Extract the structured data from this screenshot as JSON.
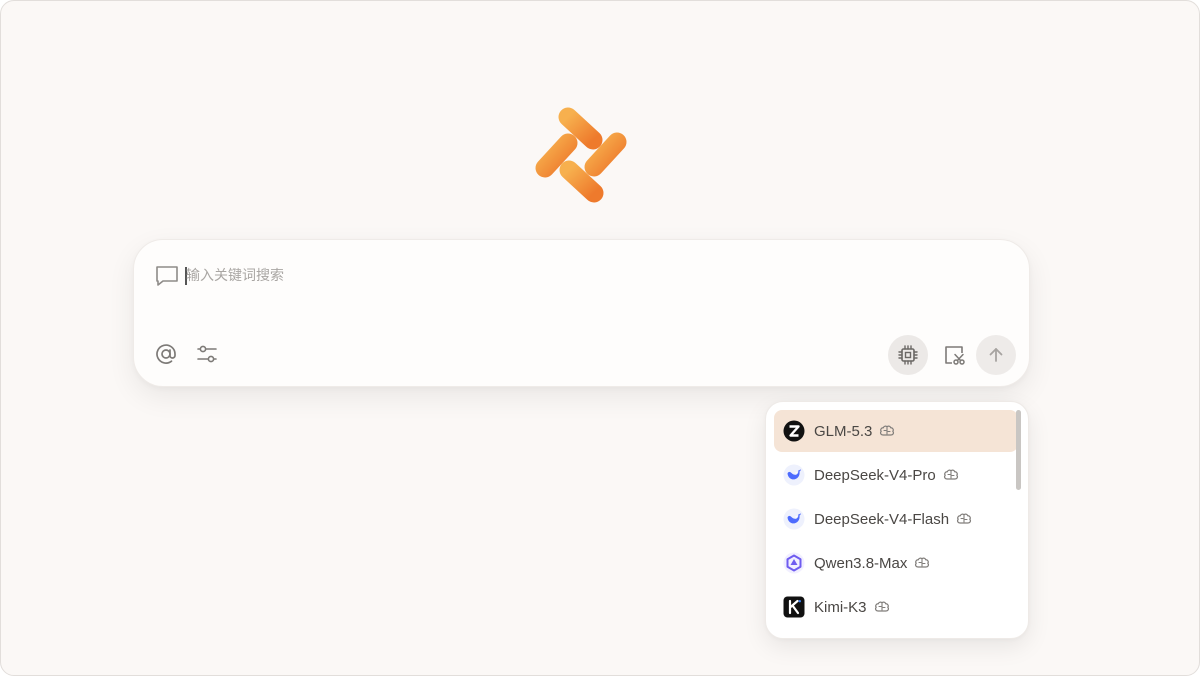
{
  "search": {
    "placeholder": "输入关键词搜索"
  },
  "toolbar": {
    "left_icons": [
      "at-icon",
      "sliders-icon"
    ],
    "right_icons": [
      "chip-icon",
      "screenshot-icon",
      "arrow-up-icon"
    ]
  },
  "colors": {
    "brand_orange": "#F2903A",
    "selected_bg": "#F5E4D6",
    "page_bg": "#FBF8F6"
  },
  "model_menu": {
    "selected_index": 0,
    "items": [
      {
        "label": "GLM-5.3",
        "icon": "zhipu-z-logo"
      },
      {
        "label": "DeepSeek-V4-Pro",
        "icon": "deepseek-whale-logo"
      },
      {
        "label": "DeepSeek-V4-Flash",
        "icon": "deepseek-whale-logo"
      },
      {
        "label": "Qwen3.8-Max",
        "icon": "qwen-logo"
      },
      {
        "label": "Kimi-K3",
        "icon": "kimi-k-logo"
      }
    ]
  }
}
